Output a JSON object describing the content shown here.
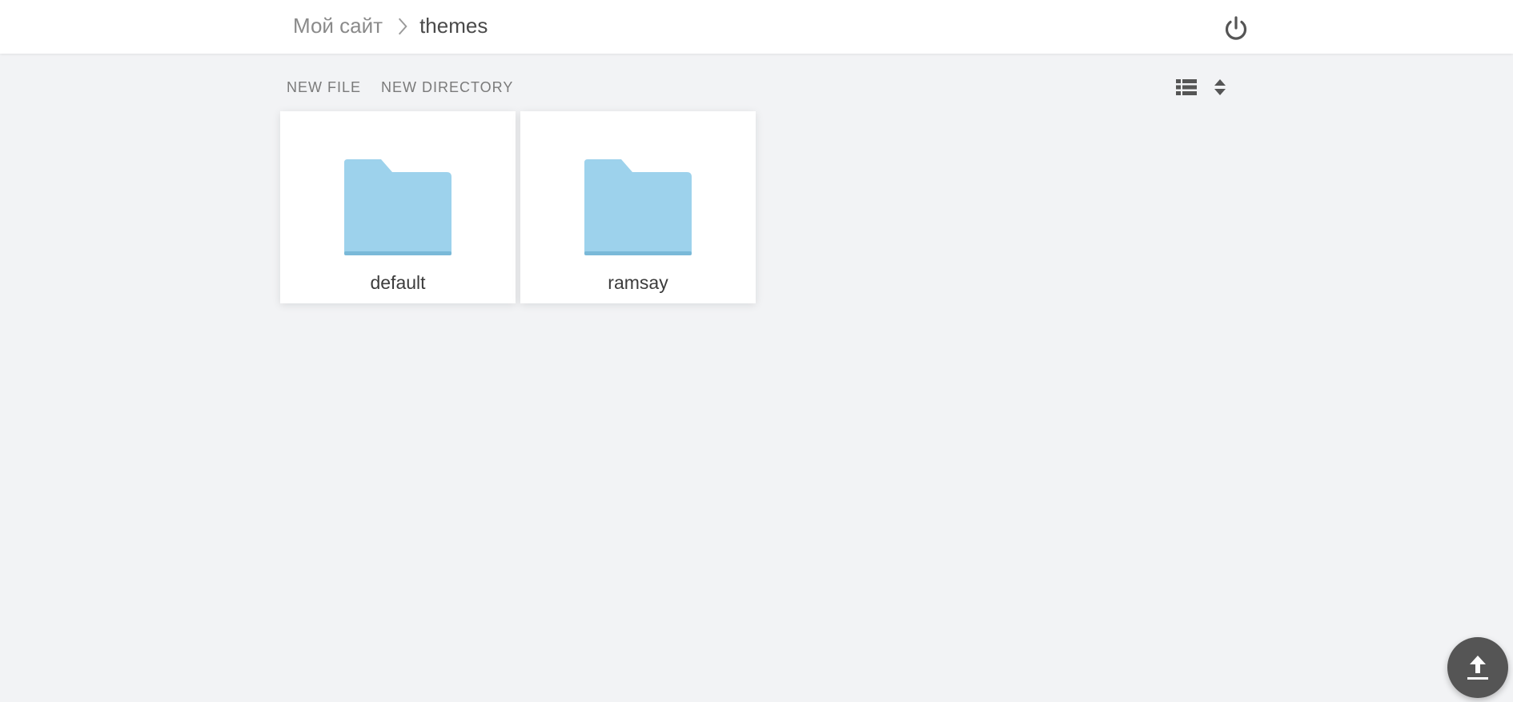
{
  "breadcrumb": {
    "root": "Мой сайт",
    "current": "themes"
  },
  "header": {
    "power_icon": "power-icon"
  },
  "toolbar": {
    "new_file_label": "New file",
    "new_directory_label": "New directory",
    "view_icon": "list-view-icon",
    "sort_icon": "sort-icon"
  },
  "items": [
    {
      "name": "default",
      "type": "folder",
      "icon": "folder-icon"
    },
    {
      "name": "ramsay",
      "type": "folder",
      "icon": "folder-icon"
    }
  ],
  "fab": {
    "icon": "upload-icon"
  },
  "colors": {
    "background": "#f2f3f5",
    "header": "#ffffff",
    "folder": "#9dd2ec",
    "folder_bottom": "#7ab9d8",
    "fab": "#555555",
    "text_muted": "#8a8a8a",
    "text_primary": "#4a4a4a"
  }
}
